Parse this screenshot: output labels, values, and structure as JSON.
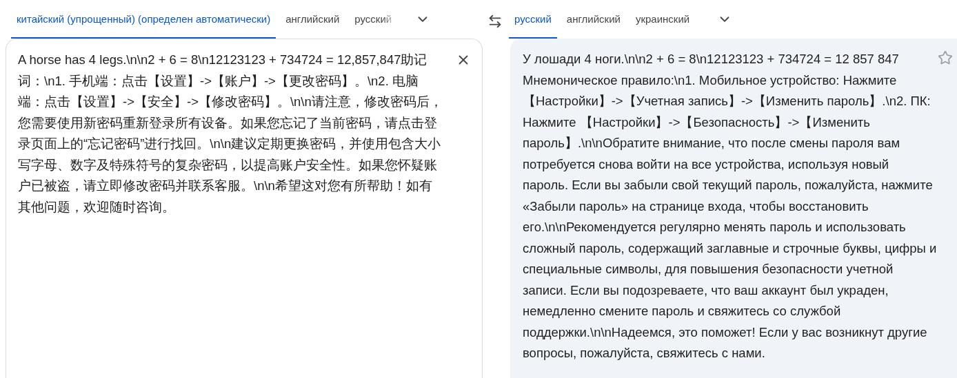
{
  "source_languages": [
    {
      "label": "китайский (упрощенный) (определен автоматически)",
      "selected": true
    },
    {
      "label": "английский",
      "selected": false
    },
    {
      "label": "русский",
      "selected": false
    }
  ],
  "target_languages": [
    {
      "label": "русский",
      "selected": true
    },
    {
      "label": "английский",
      "selected": false
    },
    {
      "label": "украинский",
      "selected": false
    }
  ],
  "source_text": "A horse has 4 legs.\\n\\n2 + 6 = 8\\n12123123 + 734724 = 12,857,847助记词：\\n1. 手机端：点击【设置】->【账户】->【更改密码】。\\n2. 电脑端：点击【设置】->【安全】->【修改密码】。\\n\\n请注意，修改密码后，您需要使用新密码重新登录所有设备。如果您忘记了当前密码，请点击登录页面上的“忘记密码”进行找回。\\n\\n建议定期更换密码，并使用包含大小写字母、数字及特殊符号的复杂密码，以提高账户安全性。如果您怀疑账户已被盗，请立即修改密码并联系客服。\\n\\n希望这对您有所帮助！如有其他问题，欢迎随时咨询。",
  "translation": "У лошади 4 ноги.\\n\\n2 + 6 = 8\\n12123123 + 734724 = 12 857 847 Мнемоническое правило:\\n1. Мобильное устройство: Нажмите 【Настройки】->【Учетная запись】->【Изменить пароль】.\\n2. ПК: Нажмите 【Настройки】->【Безопасность】->【Изменить пароль】.\\n\\nОбратите внимание, что после смены пароля вам потребуется снова войти на все устройства, используя новый пароль. Если вы забыли свой текущий пароль, пожалуйста, нажмите «Забыли пароль» на странице входа, чтобы восстановить его.\\n\\nРекомендуется регулярно менять пароль и использовать сложный пароль, содержащий заглавные и строчные буквы, цифры и специальные символы, для повышения безопасности учетной записи. Если вы подозреваете, что ваш аккаунт был украден, немедленно смените пароль и свяжитесь со службой поддержки.\\n\\nНадеемся, это поможет! Если у вас возникнут другие вопросы, пожалуйста, свяжитесь с нами."
}
